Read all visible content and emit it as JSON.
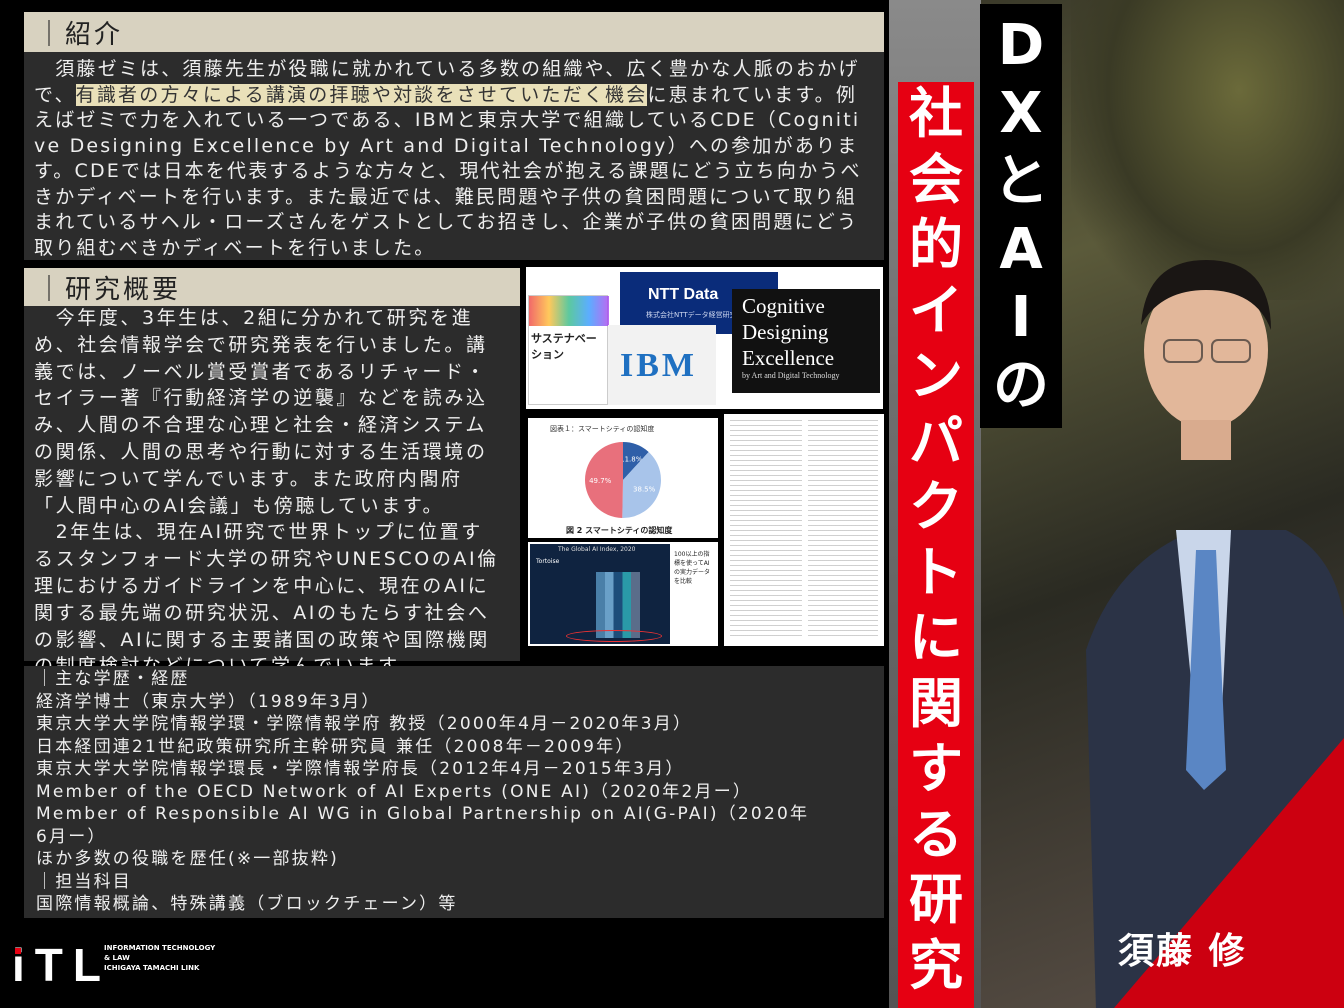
{
  "intro": {
    "heading": "｜紹介",
    "text_a": "　須藤ゼミは、須藤先生が役職に就かれている多数の組織や、広く豊かな人脈のおかげで、",
    "text_hl": "有識者の方々による講演の拝聴や対談をさせていただく機会",
    "text_b": "に恵まれています。例えばゼミで力を入れている一つである、IBMと東京大学で組織しているCDE（Cognitive Designing Excellence by Art and Digital Technology）への参加があります。CDEでは日本を代表するような方々と、現代社会が抱える課題にどう立ち向かうべきかディベートを行います。また最近では、難民問題や子供の貧困問題について取り組まれているサヘル・ローズさんをゲストとしてお招きし、企業が子供の貧困問題にどう取り組むべきかディベートを行いました。"
  },
  "research": {
    "heading": "｜研究概要",
    "p1": "　今年度、3年生は、2組に分かれて研究を進め、社会情報学会で研究発表を行いました。講義では、ノーベル賞受賞者であるリチャード・セイラー著『行動経済学の逆襲』などを読み込み、人間の不合理な心理と社会・経済システムの関係、人間の思考や行動に対する生活環境の影響について学んでいます。また政府内閣府「人間中心のAI会議」も傍聴しています。",
    "p2": "　2年生は、現在AI研究で世界トップに位置するスタンフォード大学の研究やUNESCOのAI倫理におけるガイドラインを中心に、現在のAIに関する最先端の研究状況、AIのもたらす社会への影響、AIに関する主要諸国の政策や国際機関の制度検討などについて学んでいます。"
  },
  "career": {
    "heading": "｜主な学歴・経歴",
    "items": [
      "経済学博士（東京大学）（1989年3月）",
      "東京大学大学院情報学環・学際情報学府 教授（2000年4月－2020年3月）",
      "日本経団連21世紀政策研究所主幹研究員 兼任（2008年－2009年）",
      "東京大学大学院情報学環長・学際情報学府長（2012年4月－2015年3月）",
      "Member of the OECD Network of AI Experts (ONE AI)（2020年2月ー）",
      "Member of Responsible AI WG in Global Partnership on AI(G-PAI)（2020年6月ー）",
      "ほか多数の役職を歴任(※一部抜粋)"
    ],
    "subjects_heading": "｜担当科目",
    "subjects": "国際情報概論、特殊講義（ブロックチェーン）等"
  },
  "title": {
    "top_chars": [
      "D",
      "X",
      "と",
      "A",
      "I",
      "の"
    ],
    "red_chars": [
      "社",
      "会",
      "的",
      "イ",
      "ン",
      "パ",
      "ク",
      "ト",
      "に",
      "関",
      "す",
      "る",
      "研",
      "究"
    ]
  },
  "name": "須藤 修",
  "images": {
    "book_title": "サステナベーション",
    "ntt": "NTT Data",
    "ntt_sub": "株式会社NTTデータ経営研究所",
    "ibm": "IBM",
    "cde_line1": "Cognitive",
    "cde_line2": "Designing",
    "cde_line3": "Excellence",
    "cde_sub": "by Art and Digital Technology",
    "pie_title": "図表１：スマートシティの認知度",
    "pie_caption": "図 2 スマートシティの認知度",
    "pie_values": [
      11.8,
      38.5,
      49.7
    ],
    "pie_labels": [
      "11.8%",
      "38.5%",
      "49.7%"
    ],
    "pie_colors": [
      "#2f5fa8",
      "#a8c4ea",
      "#e8707c"
    ],
    "ai_index_title": "The Global AI Index, 2020",
    "ai_index_note": "100以上の指標を使ってAIの実力データを比較",
    "tortoise": "Tortoise"
  },
  "logo": {
    "mark": "iTL",
    "line1": "INFORMATION TECHNOLOGY",
    "line2": "& LAW",
    "line3": "ICHIGAYA TAMACHI LINK"
  },
  "colors": {
    "accent_red": "#e60012",
    "panel": "#2c2c2c",
    "heading_bg": "#d8d2c0",
    "highlight": "#e9e0b9"
  }
}
